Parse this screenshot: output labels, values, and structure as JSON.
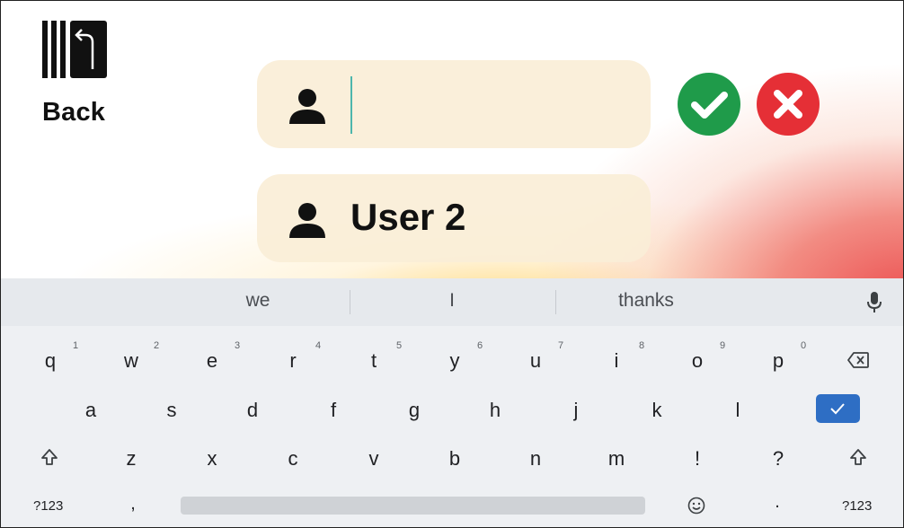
{
  "back": {
    "label": "Back",
    "icon": "back-door-arrow-icon"
  },
  "input_field": {
    "value": "",
    "icon": "user-icon"
  },
  "user2_field": {
    "name": "User 2",
    "icon": "user-icon"
  },
  "confirm_button": {
    "icon": "checkmark-icon",
    "color": "#1f9b4a"
  },
  "cancel_button": {
    "icon": "close-icon",
    "color": "#e52f36"
  },
  "keyboard": {
    "suggestions": [
      "we",
      "I",
      "thanks"
    ],
    "row1": [
      {
        "key": "q",
        "hint": "1"
      },
      {
        "key": "w",
        "hint": "2"
      },
      {
        "key": "e",
        "hint": "3"
      },
      {
        "key": "r",
        "hint": "4"
      },
      {
        "key": "t",
        "hint": "5"
      },
      {
        "key": "y",
        "hint": "6"
      },
      {
        "key": "u",
        "hint": "7"
      },
      {
        "key": "i",
        "hint": "8"
      },
      {
        "key": "o",
        "hint": "9"
      },
      {
        "key": "p",
        "hint": "0"
      }
    ],
    "row2": [
      "a",
      "s",
      "d",
      "f",
      "g",
      "h",
      "j",
      "k",
      "l"
    ],
    "row3": [
      "z",
      "x",
      "c",
      "v",
      "b",
      "n",
      "m",
      "!",
      "?"
    ],
    "symbols_left": "?123",
    "symbols_right": "?123",
    "comma": ",",
    "period": ".",
    "accent_color": "#2e6ec4"
  }
}
